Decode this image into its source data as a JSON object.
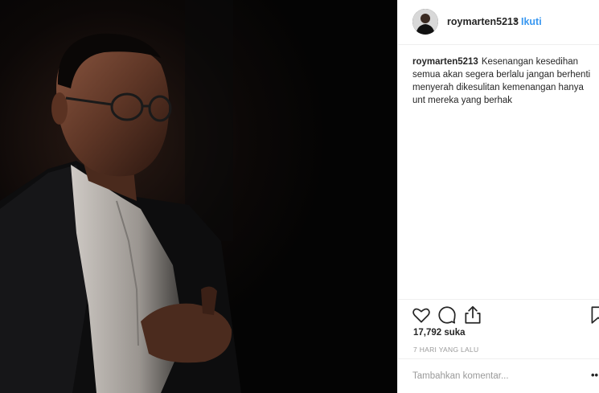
{
  "post": {
    "username": "roymarten5213",
    "separator": "•",
    "follow_label": "Ikuti",
    "caption_user": "roymarten5213",
    "caption_text": "Kesenangan kesedihan semua akan segera berlalu jangan berhenti menyerah dikesulitan kemenangan hanya unt mereka yang berhak",
    "likes": "17,792 suka",
    "time": "7 HARI YANG LALU"
  },
  "comment": {
    "placeholder": "Tambahkan komentar...",
    "more_label": "••"
  },
  "icons": {
    "like": "heart-icon",
    "comment": "comment-icon",
    "share": "share-icon",
    "save": "bookmark-icon",
    "more": "more-icon"
  },
  "colors": {
    "link": "#3897f0",
    "text": "#262626",
    "muted": "#999999",
    "divider": "#efefef"
  }
}
